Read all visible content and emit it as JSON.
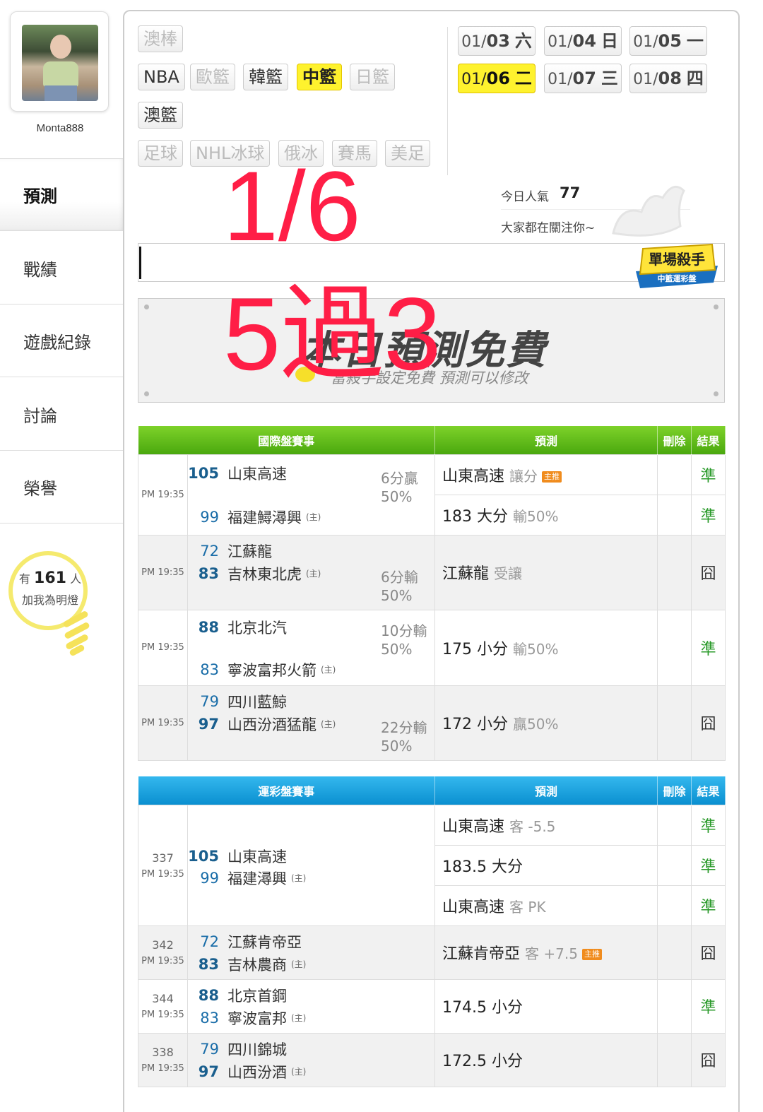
{
  "sidebar": {
    "username": "Monta888",
    "nav": [
      "預測",
      "戰績",
      "遊戲紀錄",
      "討論",
      "榮譽"
    ],
    "bulb_prefix": "有",
    "bulb_count": "161",
    "bulb_suffix": "人",
    "bulb_msg": "加我為明燈"
  },
  "sports": {
    "row1": [
      "澳棒"
    ],
    "row2": [
      "NBA",
      "歐籃",
      "韓籃",
      "中籃",
      "日籃"
    ],
    "row3": [
      "澳籃"
    ],
    "row4": [
      "足球",
      "NHL冰球",
      "俄冰",
      "賽馬",
      "美足"
    ]
  },
  "dates": [
    {
      "md": "01/",
      "d": "03",
      "w": "六"
    },
    {
      "md": "01/",
      "d": "04",
      "w": "日"
    },
    {
      "md": "01/",
      "d": "05",
      "w": "一"
    },
    {
      "md": "01/",
      "d": "06",
      "w": "二"
    },
    {
      "md": "01/",
      "d": "07",
      "w": "三"
    },
    {
      "md": "01/",
      "d": "08",
      "w": "四"
    }
  ],
  "popularity": {
    "label": "今日人氣",
    "value": "77",
    "msg": "大家都在關注你~"
  },
  "overlay": {
    "date": "1/6",
    "record": "5過3"
  },
  "killer_badge": {
    "title": "單場殺手",
    "sub": "中籃運彩盤"
  },
  "banner": {
    "title": "本日預測免費",
    "sub": "當殺手設定免費 預測可以修改"
  },
  "intl_table": {
    "headers": [
      "國際盤賽事",
      "預測",
      "刪除",
      "結果"
    ],
    "games": [
      {
        "time": "PM 19:35",
        "away_score": "105",
        "away": "山東高速",
        "home_score": "99",
        "home": "福建鱘潯興",
        "odds1": "6分贏",
        "odds2": "50%",
        "preds": [
          {
            "main": "山東高速",
            "sub": "讓分",
            "badge": "主推",
            "result": "準"
          },
          {
            "main": "183 大分",
            "sub": "輸50%",
            "badge": "",
            "result": "準"
          }
        ]
      },
      {
        "time": "PM 19:35",
        "away_score": "72",
        "away": "江蘇龍",
        "home_score": "83",
        "home": "吉林東北虎",
        "odds1": "6分輸",
        "odds2": "50%",
        "preds": [
          {
            "main": "江蘇龍",
            "sub": "受讓",
            "badge": "",
            "result": "囧"
          }
        ]
      },
      {
        "time": "PM 19:35",
        "away_score": "88",
        "away": "北京北汽",
        "home_score": "83",
        "home": "寧波富邦火箭",
        "odds1": "10分輸",
        "odds2": "50%",
        "preds": [
          {
            "main": "175 小分",
            "sub": "輸50%",
            "badge": "",
            "result": "準"
          }
        ]
      },
      {
        "time": "PM 19:35",
        "away_score": "79",
        "away": "四川藍鯨",
        "home_score": "97",
        "home": "山西汾酒猛龍",
        "odds1": "22分輸",
        "odds2": "50%",
        "preds": [
          {
            "main": "172 小分",
            "sub": "贏50%",
            "badge": "",
            "result": "囧"
          }
        ]
      }
    ]
  },
  "lottery_table": {
    "headers": [
      "運彩盤賽事",
      "預測",
      "刪除",
      "結果"
    ],
    "games": [
      {
        "id": "337",
        "time": "PM 19:35",
        "away_score": "105",
        "away": "山東高速",
        "home_score": "99",
        "home": "福建潯興",
        "preds": [
          {
            "main": "山東高速",
            "sub": "客 -5.5",
            "badge": "",
            "result": "準"
          },
          {
            "main": "183.5 大分",
            "sub": "",
            "badge": "",
            "result": "準"
          },
          {
            "main": "山東高速",
            "sub": "客 PK",
            "badge": "",
            "result": "準"
          }
        ]
      },
      {
        "id": "342",
        "time": "PM 19:35",
        "away_score": "72",
        "away": "江蘇肯帝亞",
        "home_score": "83",
        "home": "吉林農商",
        "preds": [
          {
            "main": "江蘇肯帝亞",
            "sub": "客 +7.5",
            "badge": "主推",
            "result": "囧"
          }
        ]
      },
      {
        "id": "344",
        "time": "PM 19:35",
        "away_score": "88",
        "away": "北京首鋼",
        "home_score": "83",
        "home": "寧波富邦",
        "preds": [
          {
            "main": "174.5 小分",
            "sub": "",
            "badge": "",
            "result": "準"
          }
        ]
      },
      {
        "id": "338",
        "time": "PM 19:35",
        "away_score": "79",
        "away": "四川錦城",
        "home_score": "97",
        "home": "山西汾酒",
        "preds": [
          {
            "main": "172.5 小分",
            "sub": "",
            "badge": "",
            "result": "囧"
          }
        ]
      }
    ]
  },
  "home_marker": "(主)",
  "colors": {
    "selected": "#fef22e",
    "win": "#2a9a2a",
    "intl_header": "#5ab91a",
    "lottery_header": "#1ba2df",
    "overlay": "#ff1e46"
  }
}
